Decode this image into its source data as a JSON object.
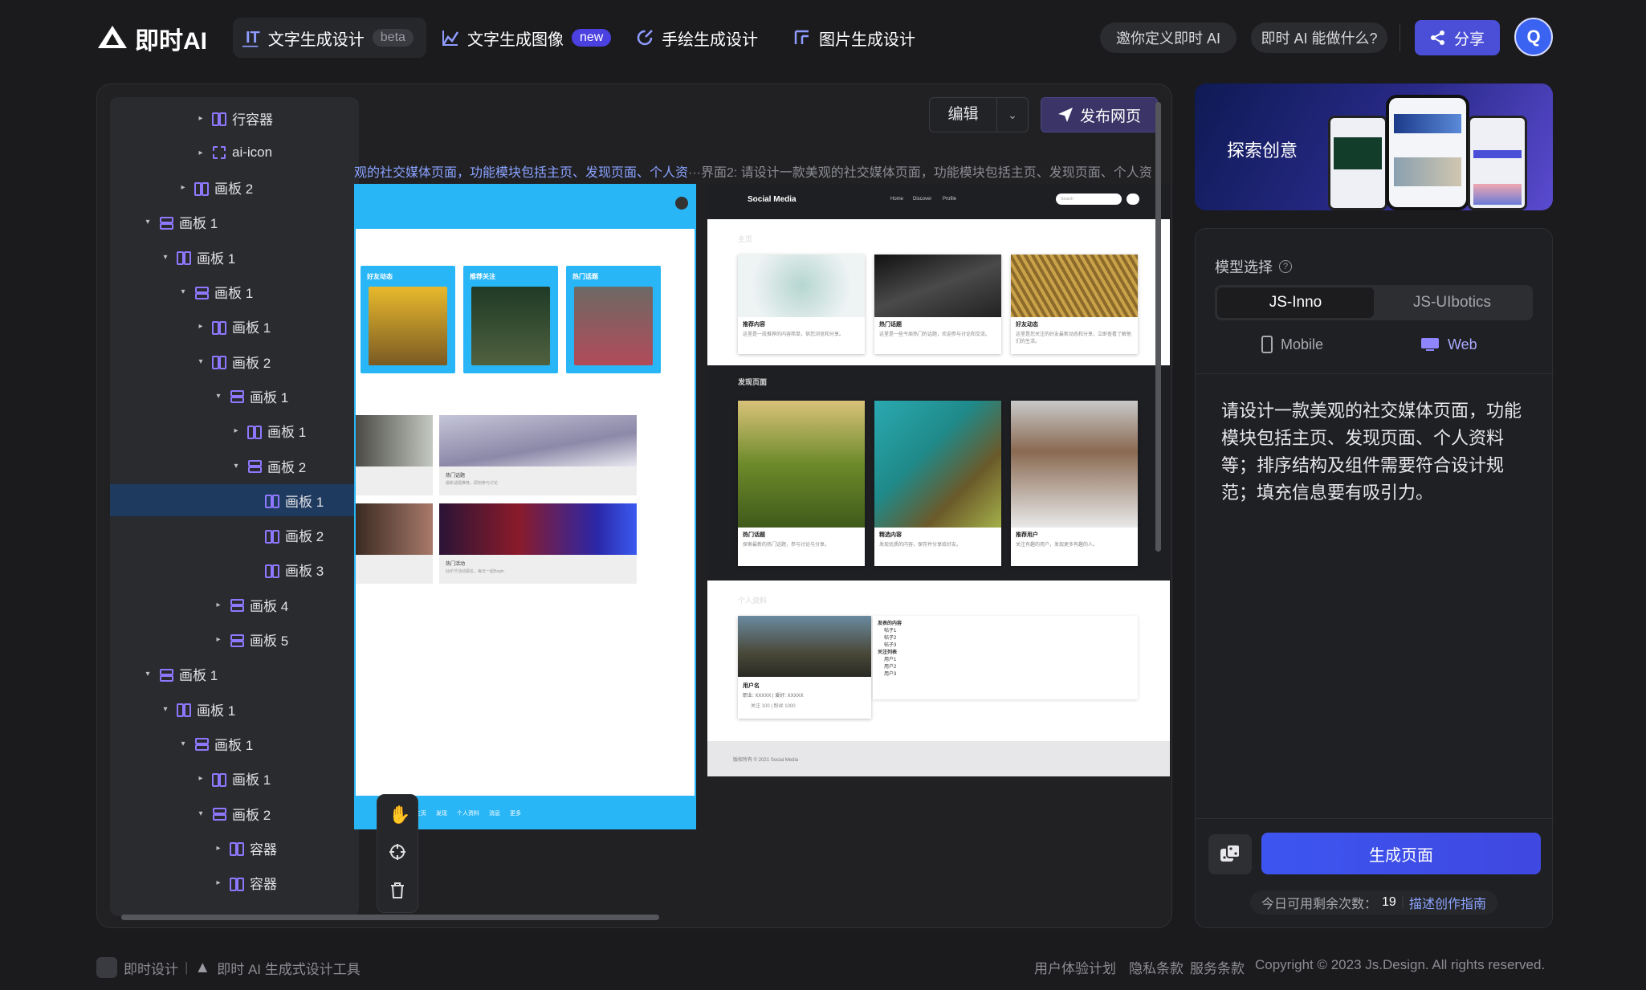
{
  "header": {
    "logo_text": "即时AI",
    "tabs": [
      {
        "label": "文字生成设计",
        "badge": "beta"
      },
      {
        "label": "文字生成图像",
        "badge": "new"
      },
      {
        "label": "手绘生成设计"
      },
      {
        "label": "图片生成设计"
      }
    ],
    "invite_label": "邀你定义即时 AI",
    "whatcan_label": "即时 AI 能做什么?",
    "share_label": "分享",
    "avatar_letter": "Q"
  },
  "toolbar": {
    "edit_label": "编辑",
    "publish_label": "发布网页"
  },
  "prompt_marquee": {
    "main": "观的社交媒体页面，功能模块包括主页、发现页面、个人资",
    "ellipsis": "···",
    "rest": "界面2: 请设计一款美观的社交媒体页面，功能模块包括主页、发现页面、个人资"
  },
  "layer_tree": [
    {
      "label": "行容器",
      "icon": "row",
      "depth": 4,
      "caret": "right"
    },
    {
      "label": "ai-icon",
      "icon": "ai",
      "depth": 4,
      "caret": "right"
    },
    {
      "label": "画板 2",
      "icon": "row",
      "depth": 3,
      "caret": "right"
    },
    {
      "label": "画板 1",
      "icon": "col",
      "depth": 1,
      "caret": "down"
    },
    {
      "label": "画板 1",
      "icon": "row",
      "depth": 2,
      "caret": "down"
    },
    {
      "label": "画板 1",
      "icon": "col",
      "depth": 3,
      "caret": "down"
    },
    {
      "label": "画板 1",
      "icon": "row",
      "depth": 4,
      "caret": "right"
    },
    {
      "label": "画板 2",
      "icon": "row",
      "depth": 4,
      "caret": "down"
    },
    {
      "label": "画板 1",
      "icon": "col",
      "depth": 5,
      "caret": "down"
    },
    {
      "label": "画板 1",
      "icon": "row",
      "depth": 6,
      "caret": "right"
    },
    {
      "label": "画板 2",
      "icon": "col",
      "depth": 6,
      "caret": "down"
    },
    {
      "label": "画板 1",
      "icon": "row",
      "depth": 7,
      "caret": "none",
      "selected": true
    },
    {
      "label": "画板 2",
      "icon": "row",
      "depth": 7,
      "caret": "none"
    },
    {
      "label": "画板 3",
      "icon": "row",
      "depth": 7,
      "caret": "none"
    },
    {
      "label": "画板 4",
      "icon": "col",
      "depth": 5,
      "caret": "right"
    },
    {
      "label": "画板 5",
      "icon": "col",
      "depth": 5,
      "caret": "right"
    },
    {
      "label": "画板 1",
      "icon": "col",
      "depth": 1,
      "caret": "down"
    },
    {
      "label": "画板 1",
      "icon": "row",
      "depth": 2,
      "caret": "down"
    },
    {
      "label": "画板 1",
      "icon": "col",
      "depth": 3,
      "caret": "down"
    },
    {
      "label": "画板 1",
      "icon": "row",
      "depth": 4,
      "caret": "right"
    },
    {
      "label": "画板 2",
      "icon": "col",
      "depth": 4,
      "caret": "down"
    },
    {
      "label": "容器",
      "icon": "row",
      "depth": 5,
      "caret": "right"
    },
    {
      "label": "容器",
      "icon": "row",
      "depth": 5,
      "caret": "right"
    }
  ],
  "mobile_preview": {
    "cards": [
      "好友动态",
      "推荐关注",
      "热门话题"
    ],
    "list": [
      {
        "title": "热门话题",
        "desc": "最新话题推荐，即刻参与讨论"
      },
      {
        "title": "热门活动",
        "desc": "仙乐节活动报名，每日一起Begin"
      }
    ],
    "bottom_nav": [
      "主页",
      "发现",
      "个人资料",
      "消息",
      "更多"
    ]
  },
  "web_preview": {
    "brand": "Social Media",
    "nav": [
      "Home",
      "Discover",
      "Profile"
    ],
    "search_placeholder": "Search",
    "sections": {
      "home": "主页",
      "discover": "发现页面",
      "profile": "个人资料"
    },
    "home_cards": [
      {
        "title": "推荐内容",
        "desc": "这里是一段推荐的内容简单，供您浏览和分享。"
      },
      {
        "title": "热门话题",
        "desc": "这里是一些今周热门的话题，欢迎参与讨论和交流。"
      },
      {
        "title": "好友动态",
        "desc": "这里是您关注的好友最新动态和分享，立即查看了解他们的生活。"
      }
    ],
    "discover_cards": [
      {
        "title": "热门话题",
        "desc": "探索最新的热门话题，参与讨论与分享。"
      },
      {
        "title": "精选内容",
        "desc": "发现优质的内容，保存并分享给好友。"
      },
      {
        "title": "推荐用户",
        "desc": "关注有趣的用户，发现更多有趣的人。"
      }
    ],
    "profile": {
      "name": "用户名",
      "meta": "职业: XXXXX | 爱好: XXXXX",
      "stats": "关注 100 | 粉丝 1000",
      "posts_title": "发表的内容",
      "posts": [
        "帖子1",
        "帖子2",
        "帖子3"
      ],
      "follow_title": "关注列表",
      "follow": [
        "用户1",
        "用户2",
        "用户3"
      ]
    },
    "footer": "版权所有 © 2021 Social Media"
  },
  "banner": {
    "title": "探索创意"
  },
  "generator": {
    "model_label": "模型选择",
    "models": [
      "JS-Inno",
      "JS-UIbotics"
    ],
    "active_model": 0,
    "devices": [
      "Mobile",
      "Web"
    ],
    "active_device": 1,
    "prompt": "请设计一款美观的社交媒体页面，功能模块包括主页、发现页面、个人资料等；排序结构及组件需要符合设计规范；填充信息要有吸引力。",
    "generate_label": "生成页面",
    "quota_prefix": "今日可用剩余次数：",
    "quota_value": "19",
    "guide_label": "描述创作指南"
  },
  "footer": {
    "brand1": "即时设计",
    "brand2": "即时 AI 生成式设计工具",
    "links": [
      "用户体验计划",
      "隐私条款",
      "服务条款"
    ],
    "copyright": "Copyright © 2023 Js.Design. All rights reserved."
  },
  "colors": {
    "accent": "#4b4fd8",
    "tree_icon": "#8f78ff",
    "mobile_primary": "#29b6f6",
    "generate": "#3d55f0"
  }
}
